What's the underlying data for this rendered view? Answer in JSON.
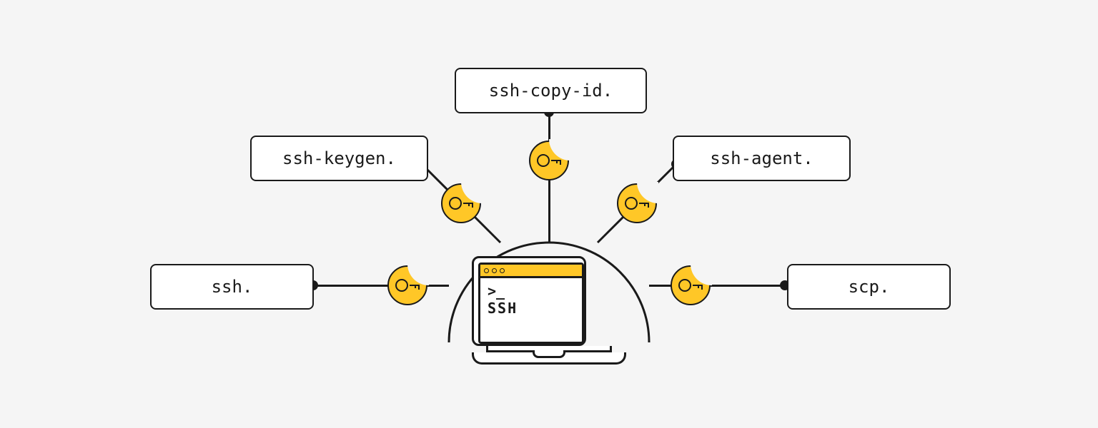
{
  "center": {
    "prompt": ">_",
    "label": "SSH"
  },
  "nodes": {
    "ssh": {
      "label": "ssh."
    },
    "keygen": {
      "label": "ssh-keygen."
    },
    "copyid": {
      "label": "ssh-copy-id."
    },
    "agent": {
      "label": "ssh-agent."
    },
    "scp": {
      "label": "scp."
    }
  },
  "colors": {
    "accent": "#ffc727",
    "ink": "#1a1a1a",
    "bg": "#f5f5f5",
    "box": "#ffffff"
  }
}
